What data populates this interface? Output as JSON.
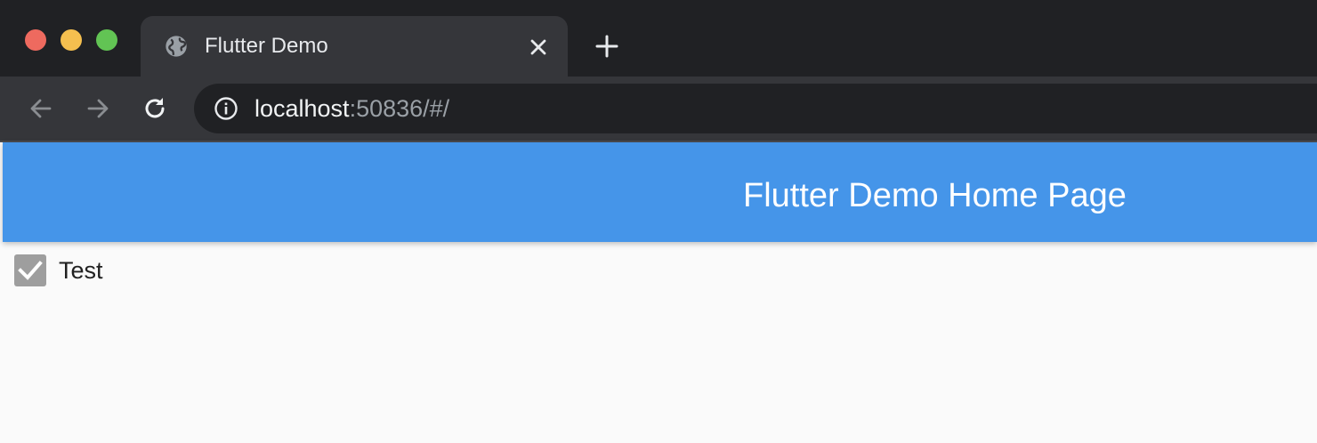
{
  "browser": {
    "tab": {
      "title": "Flutter Demo",
      "favicon": "globe-icon"
    },
    "address_bar": {
      "host": "localhost",
      "rest": ":50836/#/"
    },
    "colors": {
      "tabstrip_bg": "#202124",
      "toolbar_bg": "#35363a"
    }
  },
  "app": {
    "appbar": {
      "title": "Flutter Demo Home Page",
      "color": "#4595e9"
    },
    "checkbox": {
      "label": "Test",
      "checked": true,
      "color": "#9e9e9e"
    }
  }
}
